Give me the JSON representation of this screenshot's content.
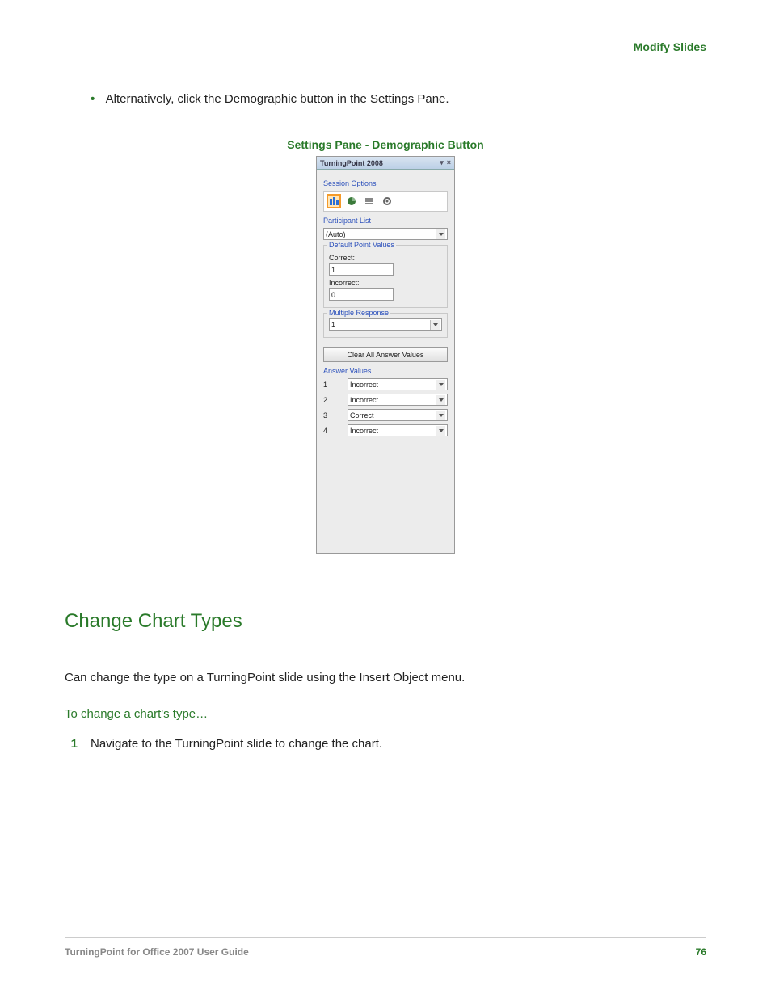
{
  "header": {
    "section": "Modify Slides"
  },
  "bullet": {
    "text": "Alternatively, click the Demographic button in the Settings Pane."
  },
  "figure": {
    "caption": "Settings Pane - Demographic Button",
    "title": "TurningPoint 2008",
    "session_options_label": "Session Options",
    "participant_list_label": "Participant List",
    "participant_list_value": "(Auto)",
    "default_point_values_label": "Default Point Values",
    "correct_label": "Correct:",
    "correct_value": "1",
    "incorrect_label": "Incorrect:",
    "incorrect_value": "0",
    "multiple_response_label": "Multiple Response",
    "multiple_response_value": "1",
    "clear_button": "Clear All Answer Values",
    "answer_values_label": "Answer Values",
    "answer_values": [
      {
        "n": "1",
        "v": "Incorrect"
      },
      {
        "n": "2",
        "v": "Incorrect"
      },
      {
        "n": "3",
        "v": "Correct"
      },
      {
        "n": "4",
        "v": "Incorrect"
      }
    ]
  },
  "section2": {
    "heading": "Change Chart Types",
    "para": "Can change the type on a TurningPoint slide using the Insert Object menu.",
    "subhead": "To change a chart's type…",
    "step1_num": "1",
    "step1_text": "Navigate to the TurningPoint slide to change the chart."
  },
  "footer": {
    "left": "TurningPoint for Office 2007 User Guide",
    "page": "76"
  }
}
